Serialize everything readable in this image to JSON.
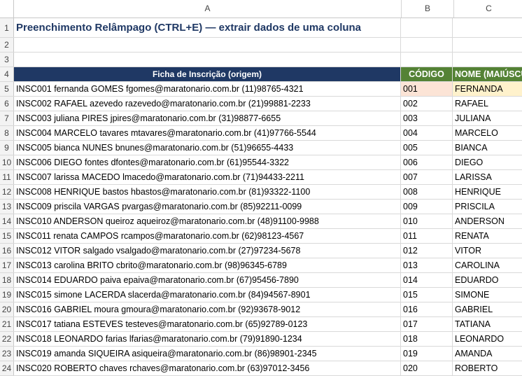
{
  "columns": [
    "A",
    "B",
    "C"
  ],
  "title": "Preenchimento Relâmpago (CTRL+E) — extrair dados de uma coluna",
  "headers": {
    "a": "Ficha de Inscrição (origem)",
    "b": "CÓDIGO",
    "c": "NOME (MAIÚSCULO)"
  },
  "row_numbers": [
    "1",
    "2",
    "3",
    "4",
    "5",
    "6",
    "7",
    "8",
    "9",
    "10",
    "11",
    "12",
    "13",
    "14",
    "15",
    "16",
    "17",
    "18",
    "19",
    "20",
    "21",
    "22",
    "23",
    "24"
  ],
  "rows": [
    {
      "a": "INSC001 fernanda GOMES fgomes@maratonario.com.br (11)98765-4321",
      "b": "001",
      "c": "FERNANDA"
    },
    {
      "a": "INSC002 RAFAEL azevedo razevedo@maratonario.com.br (21)99881-2233",
      "b": "002",
      "c": "RAFAEL"
    },
    {
      "a": "INSC003 juliana PIRES jpires@maratonario.com.br (31)98877-6655",
      "b": "003",
      "c": "JULIANA"
    },
    {
      "a": "INSC004 MARCELO tavares mtavares@maratonario.com.br (41)97766-5544",
      "b": "004",
      "c": "MARCELO"
    },
    {
      "a": "INSC005 bianca NUNES bnunes@maratonario.com.br (51)96655-4433",
      "b": "005",
      "c": "BIANCA"
    },
    {
      "a": "INSC006 DIEGO fontes dfontes@maratonario.com.br (61)95544-3322",
      "b": "006",
      "c": "DIEGO"
    },
    {
      "a": "INSC007 larissa MACEDO lmacedo@maratonario.com.br (71)94433-2211",
      "b": "007",
      "c": "LARISSA"
    },
    {
      "a": "INSC008 HENRIQUE bastos hbastos@maratonario.com.br (81)93322-1100",
      "b": "008",
      "c": "HENRIQUE"
    },
    {
      "a": "INSC009 priscila VARGAS pvargas@maratonario.com.br (85)92211-0099",
      "b": "009",
      "c": "PRISCILA"
    },
    {
      "a": "INSC010 ANDERSON queiroz aqueiroz@maratonario.com.br (48)91100-9988",
      "b": "010",
      "c": "ANDERSON"
    },
    {
      "a": "INSC011 renata CAMPOS rcampos@maratonario.com.br (62)98123-4567",
      "b": "011",
      "c": "RENATA"
    },
    {
      "a": "INSC012 VITOR salgado vsalgado@maratonario.com.br (27)97234-5678",
      "b": "012",
      "c": "VITOR"
    },
    {
      "a": "INSC013 carolina BRITO cbrito@maratonario.com.br (98)96345-6789",
      "b": "013",
      "c": "CAROLINA"
    },
    {
      "a": "INSC014 EDUARDO paiva epaiva@maratonario.com.br (67)95456-7890",
      "b": "014",
      "c": "EDUARDO"
    },
    {
      "a": "INSC015 simone LACERDA slacerda@maratonario.com.br (84)94567-8901",
      "b": "015",
      "c": "SIMONE"
    },
    {
      "a": "INSC016 GABRIEL moura gmoura@maratonario.com.br (92)93678-9012",
      "b": "016",
      "c": "GABRIEL"
    },
    {
      "a": "INSC017 tatiana ESTEVES testeves@maratonario.com.br (65)92789-0123",
      "b": "017",
      "c": "TATIANA"
    },
    {
      "a": "INSC018 LEONARDO farias lfarias@maratonario.com.br (79)91890-1234",
      "b": "018",
      "c": "LEONARDO"
    },
    {
      "a": "INSC019 amanda SIQUEIRA asiqueira@maratonario.com.br (86)98901-2345",
      "b": "019",
      "c": "AMANDA"
    },
    {
      "a": "INSC020 ROBERTO chaves rchaves@maratonario.com.br (63)97012-3456",
      "b": "020",
      "c": "ROBERTO"
    }
  ],
  "colors": {
    "header_a": "#1f3864",
    "header_bc": "#548235",
    "title": "#1f3864",
    "selected_b": "#fce4d6",
    "selected_c": "#fff2cc"
  }
}
